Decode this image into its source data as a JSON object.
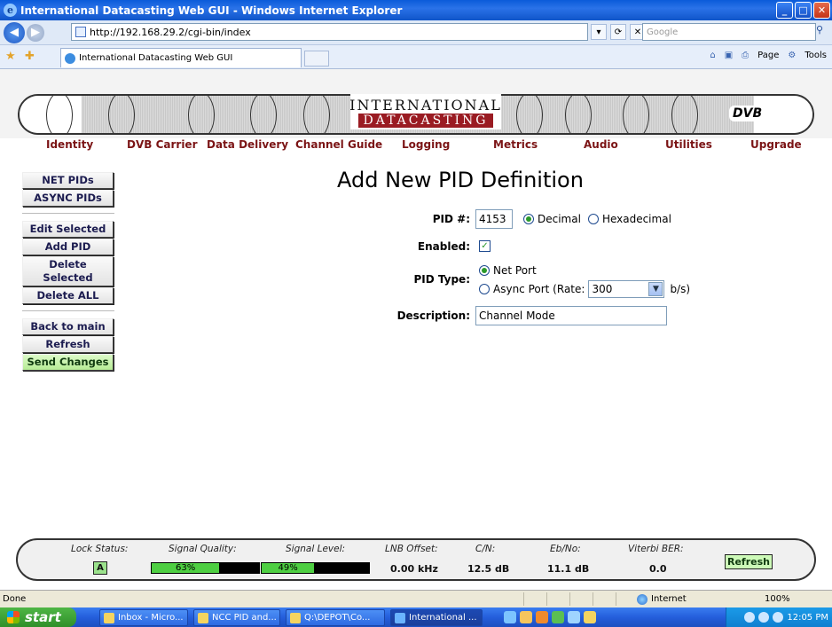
{
  "window": {
    "title": "International Datacasting Web GUI - Windows Internet Explorer",
    "minimize": "_",
    "maximize": "□",
    "close": "✕"
  },
  "browser": {
    "address": "http://192.168.29.2/cgi-bin/index",
    "search_placeholder": "Google",
    "tab_title": "International Datacasting Web GUI",
    "page_menu": "Page",
    "tools_menu": "Tools"
  },
  "banner": {
    "logo_line1": "INTERNATIONAL",
    "logo_line2": "DATACASTING",
    "dvb": "DVB"
  },
  "menu": [
    "Identity",
    "DVB Carrier",
    "Data Delivery",
    "Channel Guide",
    "Logging",
    "Metrics",
    "Audio",
    "Utilities",
    "Upgrade"
  ],
  "sidebar": {
    "group1": [
      "NET PIDs",
      "ASYNC PIDs"
    ],
    "group2": [
      "Edit Selected",
      "Add PID",
      "Delete Selected",
      "Delete ALL"
    ],
    "group3": [
      "Back to main",
      "Refresh",
      "Send Changes"
    ]
  },
  "form": {
    "title": "Add New PID Definition",
    "pid_label": "PID #:",
    "pid_value": "4153",
    "decimal_label": "Decimal",
    "hex_label": "Hexadecimal",
    "enabled_label": "Enabled:",
    "enabled": true,
    "pid_type_label": "PID Type:",
    "net_port_label": "Net Port",
    "async_label": "Async Port (Rate:",
    "rate_value": "300",
    "rate_unit": "b/s)",
    "description_label": "Description:",
    "description_value": "Channel Mode"
  },
  "status": {
    "lock_label": "Lock Status:",
    "lock_value": "A",
    "quality_label": "Signal Quality:",
    "quality_value": "63%",
    "quality_fraction": 0.63,
    "level_label": "Signal Level:",
    "level_value": "49%",
    "level_fraction": 0.49,
    "lnb_label": "LNB Offset:",
    "lnb_value": "0.00 kHz",
    "cn_label": "C/N:",
    "cn_value": "12.5 dB",
    "ebno_label": "Eb/No:",
    "ebno_value": "11.1 dB",
    "ber_label": "Viterbi BER:",
    "ber_value": "0.0",
    "refresh_label": "Refresh"
  },
  "ie_status": {
    "left": "Done",
    "zone": "Internet",
    "zoom": "100%"
  },
  "taskbar": {
    "start": "start",
    "tasks": [
      "Inbox - Micro...",
      "NCC PID and...",
      "Q:\\DEPOT\\Co...",
      "International ..."
    ],
    "clock": "12:05 PM"
  }
}
